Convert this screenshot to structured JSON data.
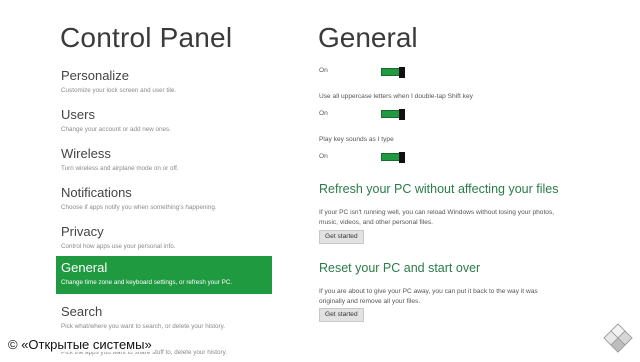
{
  "left_panel": {
    "title": "Control Panel",
    "items": [
      {
        "label": "Personalize",
        "desc": "Customize your lock screen and user tile."
      },
      {
        "label": "Users",
        "desc": "Change your account or add new ones."
      },
      {
        "label": "Wireless",
        "desc": "Turn wireless and airplane mode on or off."
      },
      {
        "label": "Notifications",
        "desc": "Choose if apps notify you when something's happening."
      },
      {
        "label": "Privacy",
        "desc": "Control how apps use your personal info."
      },
      {
        "label": "General",
        "desc": "Change time zone and keyboard settings, or refresh your PC.",
        "selected": true
      },
      {
        "label": "Search",
        "desc": "Pick what/where you want to search, or delete your history."
      },
      {
        "label": "",
        "desc": "Pick the apps you want to share stuff to, delete your history."
      }
    ]
  },
  "right_panel": {
    "title": "General",
    "toggles": [
      {
        "label": "",
        "state": "On"
      },
      {
        "label": "Use all uppercase letters when I double-tap Shift key",
        "state": "On"
      },
      {
        "label": "Play key sounds as I type",
        "state": "On"
      }
    ],
    "refresh": {
      "title": "Refresh your PC without affecting your files",
      "desc": "If your PC isn't running well, you can reload Windows without losing your photos, music, videos, and other personal files.",
      "button": "Get started"
    },
    "reset": {
      "title": "Reset your PC and start over",
      "desc": "If you are about to give your PC away, you can put it back to the way it was originally and remove all your files.",
      "button": "Get started"
    }
  },
  "credit": "© «Открытые системы»",
  "colors": {
    "accent": "#1f9a41",
    "section_title": "#2a7c4a"
  }
}
